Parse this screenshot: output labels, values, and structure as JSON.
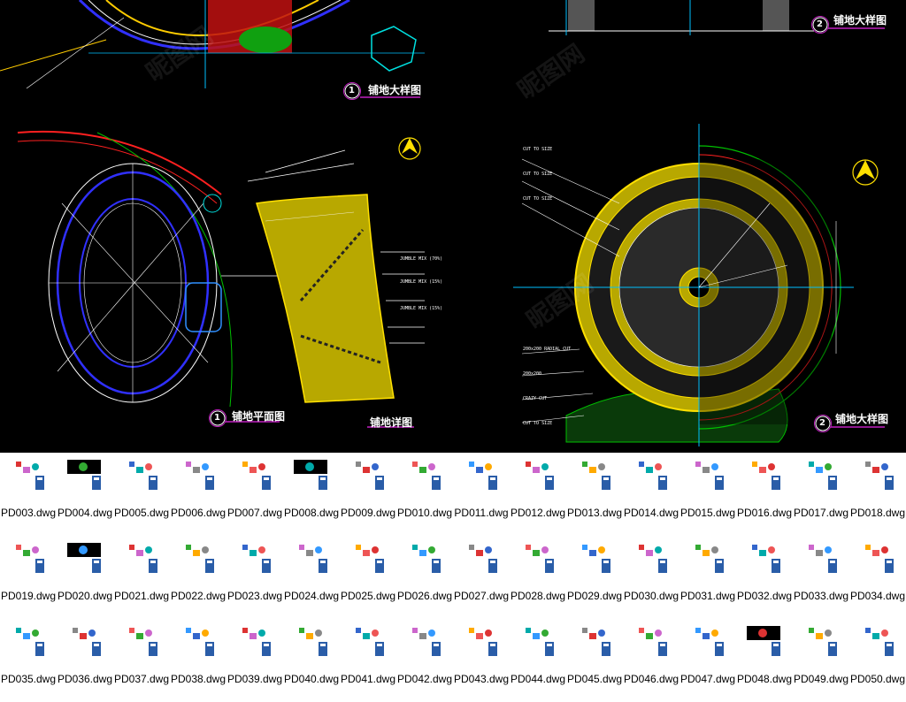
{
  "cad": {
    "labels": {
      "top_right": "铺地大样图",
      "top_left": "铺地大样图",
      "mid_left_plan": "铺地平面图",
      "mid_left_detail": "铺地详图",
      "mid_right": "铺地大样图"
    },
    "markers": {
      "top_left": "1",
      "top_right": "2",
      "mid_left": "1",
      "mid_right": "2"
    },
    "annotations": {
      "cut_to_size_1": "CUT TO SIZE",
      "cut_to_size_2": "CUT TO SIZE",
      "cut_to_size_3": "CUT TO SIZE",
      "radial_cut": "200x200 RADIAL CUT",
      "size_200": "200x200",
      "crazy_cut": "CRAZY CUT",
      "cut_to_size_4": "CUT TO SIZE",
      "jumble_1": "JUMBLE MIX (70%)",
      "jumble_2": "JUMBLE MIX (15%)",
      "jumble_3": "JUMBLE MIX (15%)"
    }
  },
  "files": [
    {
      "name": "PD003.dwg"
    },
    {
      "name": "PD004.dwg"
    },
    {
      "name": "PD005.dwg"
    },
    {
      "name": "PD006.dwg"
    },
    {
      "name": "PD007.dwg"
    },
    {
      "name": "PD008.dwg"
    },
    {
      "name": "PD009.dwg"
    },
    {
      "name": "PD010.dwg"
    },
    {
      "name": "PD011.dwg"
    },
    {
      "name": "PD012.dwg"
    },
    {
      "name": "PD013.dwg"
    },
    {
      "name": "PD014.dwg"
    },
    {
      "name": "PD015.dwg"
    },
    {
      "name": "PD016.dwg"
    },
    {
      "name": "PD017.dwg"
    },
    {
      "name": "PD018.dwg"
    },
    {
      "name": "PD019.dwg"
    },
    {
      "name": "PD020.dwg"
    },
    {
      "name": "PD021.dwg"
    },
    {
      "name": "PD022.dwg"
    },
    {
      "name": "PD023.dwg"
    },
    {
      "name": "PD024.dwg"
    },
    {
      "name": "PD025.dwg"
    },
    {
      "name": "PD026.dwg"
    },
    {
      "name": "PD027.dwg"
    },
    {
      "name": "PD028.dwg"
    },
    {
      "name": "PD029.dwg"
    },
    {
      "name": "PD030.dwg"
    },
    {
      "name": "PD031.dwg"
    },
    {
      "name": "PD032.dwg"
    },
    {
      "name": "PD033.dwg"
    },
    {
      "name": "PD034.dwg"
    },
    {
      "name": "PD035.dwg"
    },
    {
      "name": "PD036.dwg"
    },
    {
      "name": "PD037.dwg"
    },
    {
      "name": "PD038.dwg"
    },
    {
      "name": "PD039.dwg"
    },
    {
      "name": "PD040.dwg"
    },
    {
      "name": "PD041.dwg"
    },
    {
      "name": "PD042.dwg"
    },
    {
      "name": "PD043.dwg"
    },
    {
      "name": "PD044.dwg"
    },
    {
      "name": "PD045.dwg"
    },
    {
      "name": "PD046.dwg"
    },
    {
      "name": "PD047.dwg"
    },
    {
      "name": "PD048.dwg"
    },
    {
      "name": "PD049.dwg"
    },
    {
      "name": "PD050.dwg"
    }
  ]
}
